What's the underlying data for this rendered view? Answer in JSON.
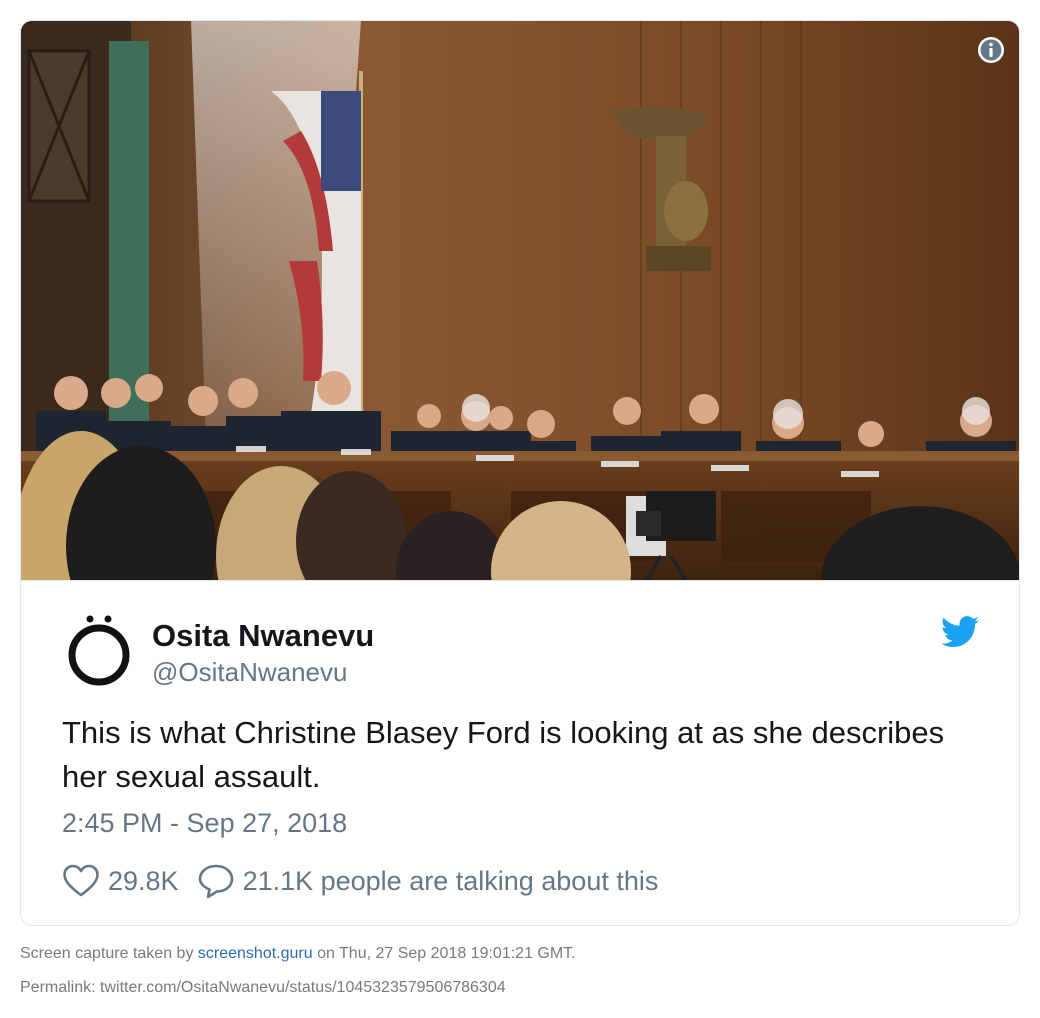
{
  "media": {
    "info_icon": "info-icon",
    "colors": {
      "wall": "#7a4a26",
      "dais": "#5b3418",
      "flag_red": "#b33a3a"
    }
  },
  "tweet": {
    "author_name": "Osita Nwanevu",
    "handle": "@OsitaNwanevu",
    "avatar_icon": "o-umlaut-avatar",
    "platform_icon": "twitter-bird-icon",
    "text": "This is what Christine Blasey Ford is looking at as she describes her sexual assault.",
    "timestamp": "2:45 PM - Sep 27, 2018",
    "likes": "29.8K",
    "talking": "21.1K people are talking about this",
    "colors": {
      "brand": "#1da1f2",
      "text": "#14171a",
      "muted": "#657786"
    }
  },
  "footer": {
    "capture_prefix": "Screen capture taken by ",
    "capture_link": "screenshot.guru",
    "capture_suffix": " on Thu, 27 Sep 2018 19:01:21 GMT.",
    "permalink": "Permalink: twitter.com/OsitaNwanevu/status/1045323579506786304"
  }
}
